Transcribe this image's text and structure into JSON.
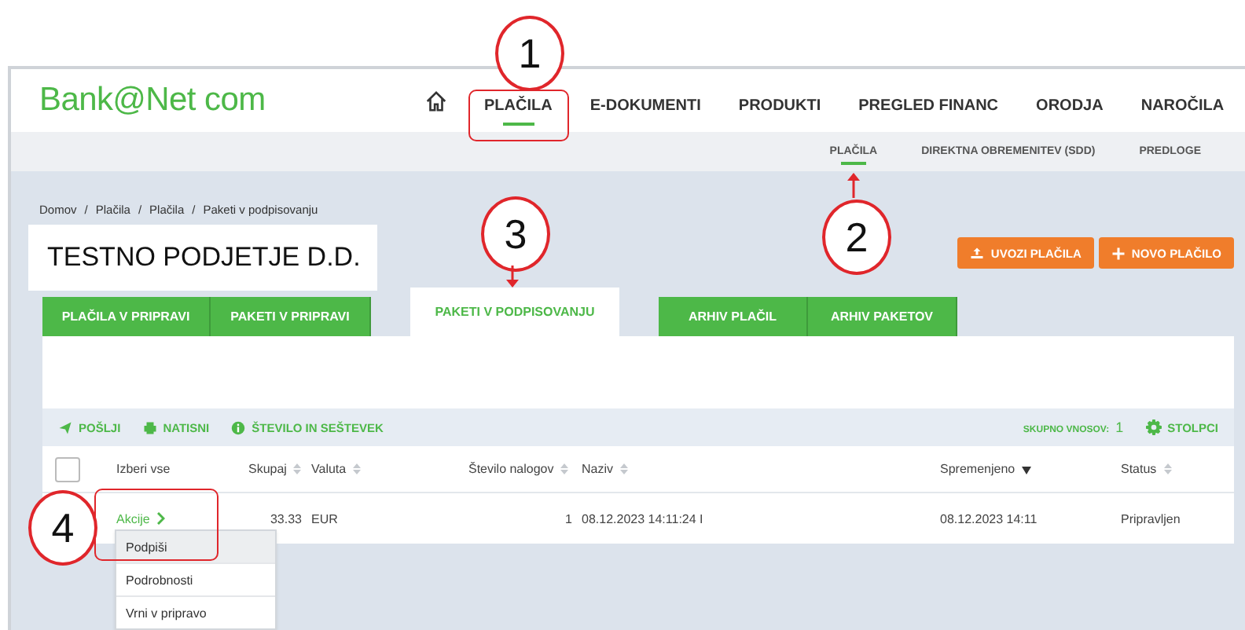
{
  "header": {
    "logo": "Bank@Net com",
    "nav": [
      {
        "label": "PLAČILA",
        "selected": true
      },
      {
        "label": "E-DOKUMENTI",
        "selected": false
      },
      {
        "label": "PRODUKTI",
        "selected": false
      },
      {
        "label": "PREGLED FINANC",
        "selected": false
      },
      {
        "label": "ORODJA",
        "selected": false
      },
      {
        "label": "NAROČILA",
        "selected": false
      }
    ]
  },
  "subnav": [
    {
      "label": "PLAČILA",
      "selected": true
    },
    {
      "label": "DIREKTNA OBREMENITEV (SDD)",
      "selected": false
    },
    {
      "label": "PREDLOGE",
      "selected": false
    }
  ],
  "breadcrumb": [
    "Domov",
    "/",
    "Plačila",
    "/",
    "Plačila",
    "/",
    "Paketi v podpisovanju"
  ],
  "company": "TESTNO PODJETJE D.D.",
  "actions": [
    {
      "label": "UVOZI PLAČILA",
      "kind": "upload"
    },
    {
      "label": "NOVO PLAČILO",
      "kind": "add"
    }
  ],
  "tabs": [
    {
      "label": "PLAČILA V PRIPRAVI",
      "selected": false
    },
    {
      "label": "PAKETI V PRIPRAVI",
      "selected": false
    },
    {
      "label": "PAKETI V PODPISOVANJU",
      "selected": true
    },
    {
      "label": "ARHIV PLAČIL",
      "selected": false
    },
    {
      "label": "ARHIV PAKETOV",
      "selected": false
    }
  ],
  "toolbar": {
    "items": [
      {
        "label": "POŠLJI",
        "kind": "send"
      },
      {
        "label": "NATISNI",
        "kind": "print"
      },
      {
        "label": "ŠTEVILO IN SEŠTEVEK",
        "kind": "info"
      }
    ],
    "count_label": "SKUPNO VNOSOV:",
    "count": "1",
    "columns_button": "STOLPCI"
  },
  "table": {
    "select_all": {
      "checked": false
    },
    "columns": [
      {
        "label": "Izberi vse",
        "sortable": false
      },
      {
        "label": "Skupaj",
        "sortable": true,
        "sorted_descending": false
      },
      {
        "label": "Valuta",
        "sortable": true,
        "sorted_descending": false
      },
      {
        "label": "Število nalogov",
        "sortable": true,
        "sorted_descending": false
      },
      {
        "label": "Naziv",
        "sortable": true,
        "sorted_descending": false
      },
      {
        "label": "Spremenjeno",
        "sortable": true,
        "sorted_descending": true
      },
      {
        "label": "Status",
        "sortable": true,
        "sorted_descending": false
      }
    ],
    "rows": [
      {
        "cells": [
          "Akcije",
          "33.33",
          "EUR",
          "1",
          "08.12.2023 14:11:24 I",
          "08.12.2023 14:11",
          "Pripravljen"
        ]
      }
    ]
  },
  "menu": [
    {
      "label": "Podpiši",
      "selected": true
    },
    {
      "label": "Podrobnosti",
      "selected": false
    },
    {
      "label": "Vrni v pripravo",
      "selected": false
    }
  ],
  "annotations": [
    {
      "number": "1"
    },
    {
      "number": "2"
    },
    {
      "number": "3"
    },
    {
      "number": "4"
    }
  ]
}
